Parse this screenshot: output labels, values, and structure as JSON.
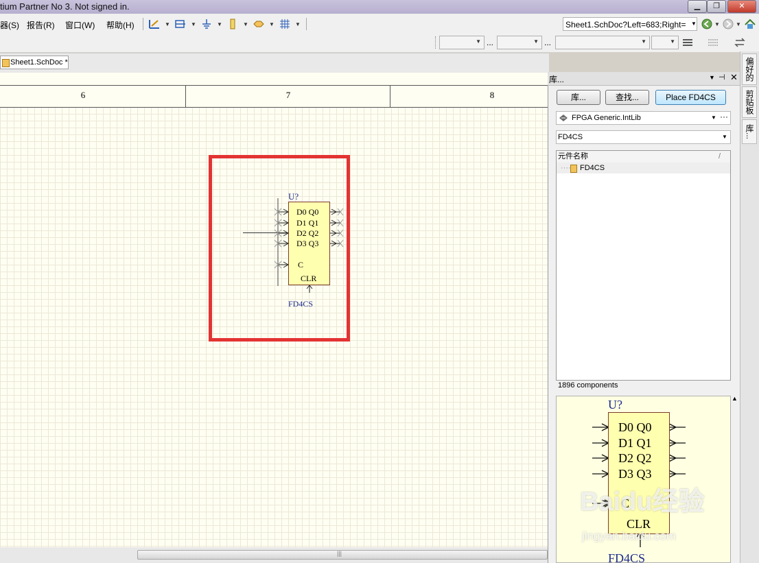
{
  "window": {
    "title": "tium Partner No 3. Not signed in."
  },
  "menu": {
    "items": [
      "器(S)",
      "报告(R)",
      "窗口(W)",
      "帮助(H)"
    ]
  },
  "address": {
    "value": "Sheet1.SchDoc?Left=683;Right="
  },
  "toolbar2": {
    "ellipsis": "..."
  },
  "tabs": {
    "doc_tab": "Sheet1.SchDoc *"
  },
  "sheet": {
    "ruler_labels": [
      "6",
      "7",
      "8"
    ],
    "component": {
      "designator": "U?",
      "comment": "FD4CS",
      "pin_rows": [
        "D0  Q0",
        "D1  Q1",
        "D2  Q2",
        "D3  Q3"
      ],
      "clock_pin": "C",
      "clear_pin": "CLR"
    },
    "highlight_color": "#e33333"
  },
  "panel": {
    "title": "库...",
    "buttons": {
      "libraries": "库...",
      "search": "查找...",
      "place": "Place FD4CS"
    },
    "library_select": "FPGA Generic.IntLib",
    "filter": "FD4CS",
    "list": {
      "column_header": "元件名称",
      "sort_indicator": "/",
      "rows": [
        "FD4CS"
      ]
    },
    "status": "1896 components",
    "preview": {
      "designator": "U?",
      "comment": "FD4CS",
      "pin_rows": [
        "D0  Q0",
        "D1  Q1",
        "D2  Q2",
        "D3  Q3"
      ],
      "clock_pin": "C",
      "clear_pin": "CLR"
    }
  },
  "side_tabs": [
    "偏好的",
    "剪贴板",
    "库..."
  ],
  "watermark": {
    "brand": "Baidu经验",
    "url": "jingyan.baidu.com"
  }
}
